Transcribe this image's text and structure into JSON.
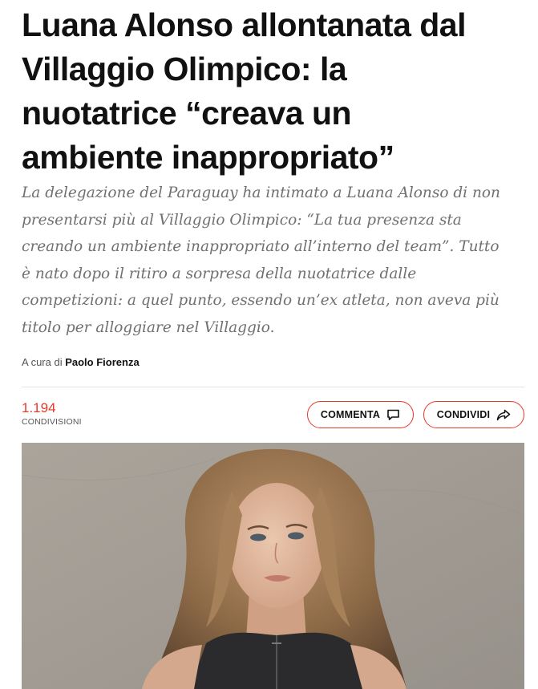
{
  "article": {
    "headline_lines": [
      "Luana Alonso allontanata dal",
      "Villaggio Olimpico: la",
      "nuotatrice “creava un",
      "ambiente inappropriato”"
    ],
    "subtitle_lines": [
      "La delegazione del Paraguay ha intimato a Luana Alonso di non",
      "presentarsi più al Villaggio Olimpico: “La tua presenza sta",
      "creando un ambiente inappropriato all’interno del team”. Tutto",
      "è nato dopo il ritiro a sorpresa della nuotatrice dalle",
      "competizioni: a quel punto, essendo un’ex atleta, non aveva più",
      "titolo per alloggiare nel Villaggio."
    ],
    "byline": {
      "prefix": "A cura di",
      "author": "Paolo Fiorenza"
    }
  },
  "shares": {
    "count": "1.194",
    "label": "CONDIVISIONI"
  },
  "actions": {
    "comment_label": "COMMENTA",
    "comment_icon": "comment-icon",
    "share_label": "CONDIVIDI",
    "share_icon": "share-arrow-icon"
  },
  "colors": {
    "accent": "#e8382b",
    "subtitle": "#707070"
  }
}
